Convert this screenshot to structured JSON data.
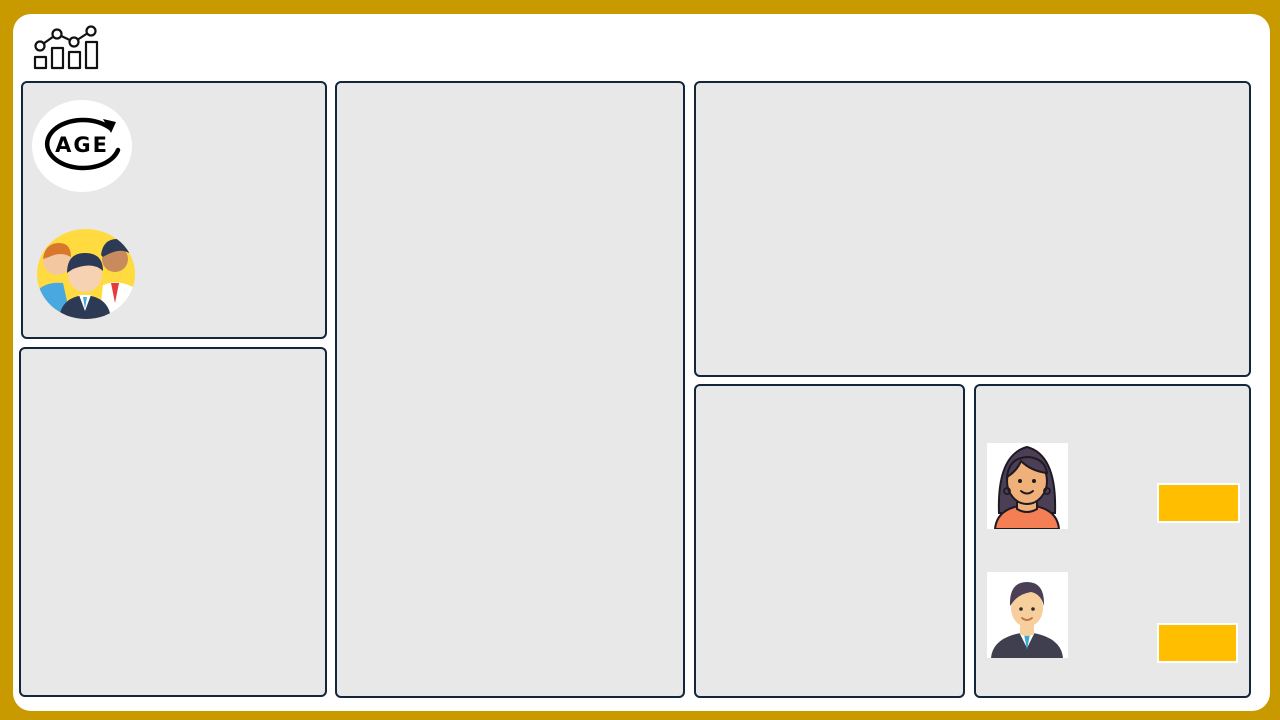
{
  "colors": {
    "background": "#c99a00",
    "frame": "#ffffff",
    "card_fill": "#e8e8e8",
    "card_border": "#14263a",
    "accent_slot": "#ffbe00"
  },
  "icons": {
    "logo": "chart-analytics-icon",
    "age": "age-icon",
    "group": "people-group-icon",
    "female": "female-avatar-icon",
    "male": "male-avatar-icon"
  },
  "age_badge": {
    "text": "AGE"
  }
}
